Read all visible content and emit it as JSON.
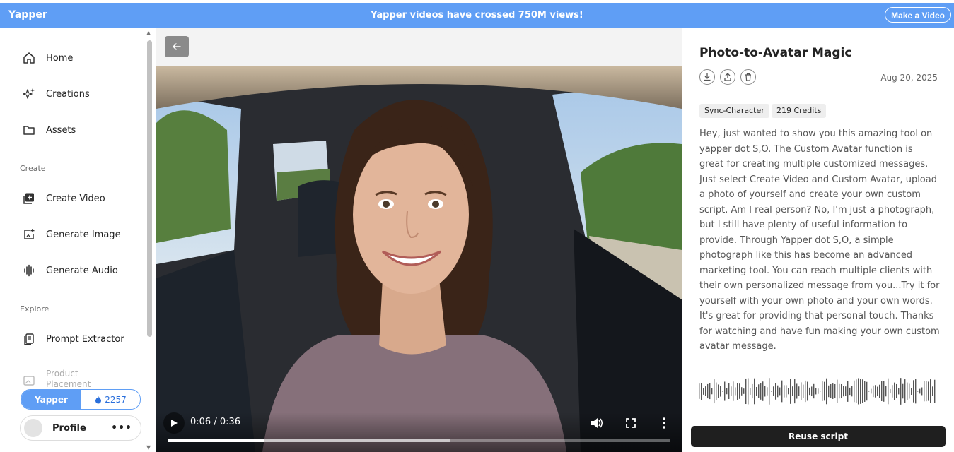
{
  "topbar": {
    "brand": "Yapper",
    "announcement": "Yapper videos have crossed 750M views!",
    "cta": "Make a Video"
  },
  "sidebar": {
    "items": [
      {
        "label": "Home",
        "icon": "home-icon"
      },
      {
        "label": "Creations",
        "icon": "sparkle-icon"
      },
      {
        "label": "Assets",
        "icon": "folder-icon"
      }
    ],
    "create_heading": "Create",
    "create_items": [
      {
        "label": "Create Video",
        "icon": "video-add-icon"
      },
      {
        "label": "Generate Image",
        "icon": "image-add-icon"
      },
      {
        "label": "Generate Audio",
        "icon": "audio-wave-icon"
      }
    ],
    "explore_heading": "Explore",
    "explore_items": [
      {
        "label": "Prompt Extractor",
        "icon": "document-icon"
      },
      {
        "label": "Product Placement",
        "icon": "placement-icon"
      }
    ],
    "plan": "Yapper",
    "credits": "2257",
    "profile_label": "Profile",
    "more": "•••"
  },
  "player": {
    "current_time": "0:06",
    "duration": "0:36",
    "time_display": "0:06 / 0:36",
    "played_fraction": 0.1915,
    "buffered_fraction": 0.5613
  },
  "detail": {
    "title": "Photo-to-Avatar Magic",
    "date": "Aug 20, 2025",
    "tags": [
      "Sync-Character",
      "219 Credits"
    ],
    "script": "Hey, just wanted to show you this amazing tool on yapper dot S,O. The Custom Avatar function is great for creating multiple customized messages. Just select Create Video and Custom Avatar, upload a photo of yourself and create your own custom script. Am I real person? No, I'm just a photograph, but I still have plenty of useful information to provide. Through Yapper dot S,O, a simple photograph like this has become an advanced marketing tool. You can reach multiple clients with their own personalized message from you...Try it for yourself with your own photo and your own words. It's great for providing that personal touch. Thanks for watching and have fun making your own custom avatar message.",
    "reuse_label": "Reuse script"
  },
  "colors": {
    "brand": "#5f9ef5",
    "dark_button": "#1f1f1f"
  }
}
